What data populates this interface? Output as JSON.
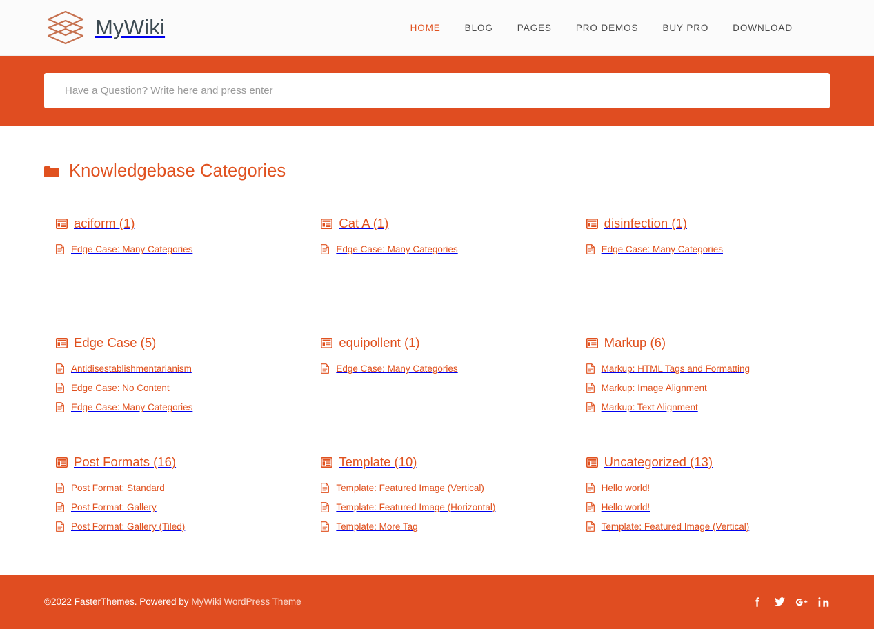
{
  "header": {
    "brand_name": "MyWiki",
    "logo_icon": "stacked-layers-logo",
    "nav": [
      {
        "label": "HOME",
        "active": true
      },
      {
        "label": "BLOG",
        "active": false
      },
      {
        "label": "PAGES",
        "active": false
      },
      {
        "label": "PRO DEMOS",
        "active": false
      },
      {
        "label": "BUY PRO",
        "active": false
      },
      {
        "label": "DOWNLOAD",
        "active": false
      }
    ]
  },
  "search": {
    "placeholder": "Have a Question? Write here and press enter",
    "value": "",
    "band_color": "#e04d21"
  },
  "main": {
    "section_title": "Knowledgebase Categories",
    "section_icon": "folder-icon",
    "categories": [
      {
        "name": "aciform (1)",
        "icon": "category-list-icon",
        "articles": [
          "Edge Case: Many Categories"
        ]
      },
      {
        "name": "Cat A (1)",
        "icon": "category-list-icon",
        "articles": [
          "Edge Case: Many Categories"
        ]
      },
      {
        "name": "disinfection (1)",
        "icon": "category-list-icon",
        "articles": [
          "Edge Case: Many Categories"
        ]
      },
      {
        "name": "Edge Case (5)",
        "icon": "category-list-icon",
        "articles": [
          "Antidisestablishmentarianism",
          "Edge Case: No Content",
          "Edge Case: Many Categories"
        ]
      },
      {
        "name": "equipollent (1)",
        "icon": "category-list-icon",
        "articles": [
          "Edge Case: Many Categories"
        ]
      },
      {
        "name": "Markup (6)",
        "icon": "category-list-icon",
        "articles": [
          "Markup: HTML Tags and Formatting",
          "Markup: Image Alignment",
          "Markup: Text Alignment"
        ]
      },
      {
        "name": "Post Formats (16)",
        "icon": "category-list-icon",
        "articles": [
          "Post Format: Standard",
          "Post Format: Gallery",
          "Post Format: Gallery (Tiled)"
        ]
      },
      {
        "name": "Template (10)",
        "icon": "category-list-icon",
        "articles": [
          "Template: Featured Image (Vertical)",
          "Template: Featured Image (Horizontal)",
          "Template: More Tag"
        ]
      },
      {
        "name": "Uncategorized (13)",
        "icon": "category-list-icon",
        "articles": [
          "Hello world!",
          "Hello world!",
          "Template: Featured Image (Vertical)"
        ]
      }
    ]
  },
  "footer": {
    "copyright_prefix": "©2022 FasterThemes. Powered by ",
    "theme_name": "MyWiki WordPress Theme",
    "social": [
      {
        "name": "facebook-icon",
        "label": "f"
      },
      {
        "name": "twitter-icon",
        "label": "t"
      },
      {
        "name": "google-plus-icon",
        "label": "G+"
      },
      {
        "name": "linkedin-icon",
        "label": "in"
      }
    ]
  },
  "colors": {
    "accent": "#e04d21",
    "accent_text": "#e0511f",
    "header_bg": "#fbfbfb",
    "brand_text": "#3d4b53",
    "nav_text": "#4a4a4a"
  }
}
